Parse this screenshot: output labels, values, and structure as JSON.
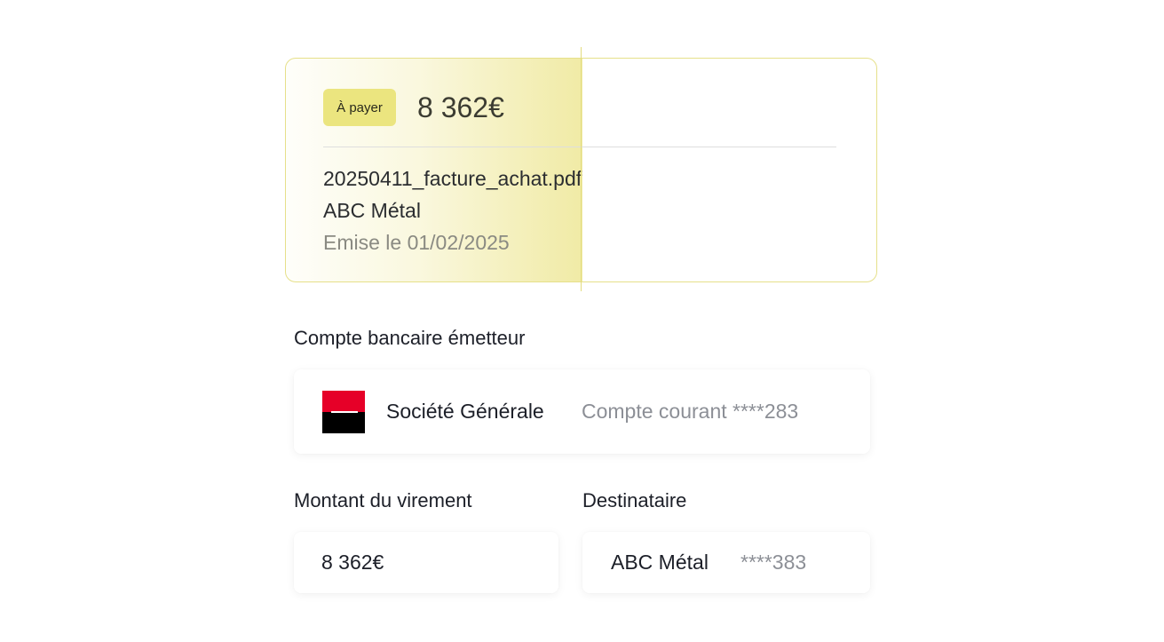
{
  "invoice": {
    "status_badge": "À payer",
    "amount": "8 362€",
    "file_name": "20250411_facture_achat.pdf",
    "vendor": "ABC Métal",
    "issue_date": "Emise le 01/02/2025"
  },
  "account_section": {
    "label": "Compte bancaire émetteur",
    "bank_name": "Société Générale",
    "account_desc": "Compte courant ****283",
    "bank_logo_icon": "societe-generale-logo-icon",
    "logo_colors": {
      "top": "#e60028",
      "bottom": "#000000"
    }
  },
  "amount_section": {
    "label": "Montant du virement",
    "value": "8 362€"
  },
  "recipient_section": {
    "label": "Destinataire",
    "name": "ABC Métal",
    "account_mask": "****383"
  },
  "colors": {
    "accent_yellow": "#ebe57f",
    "border_yellow": "#e6e08a",
    "muted_text": "#8c8f96"
  }
}
